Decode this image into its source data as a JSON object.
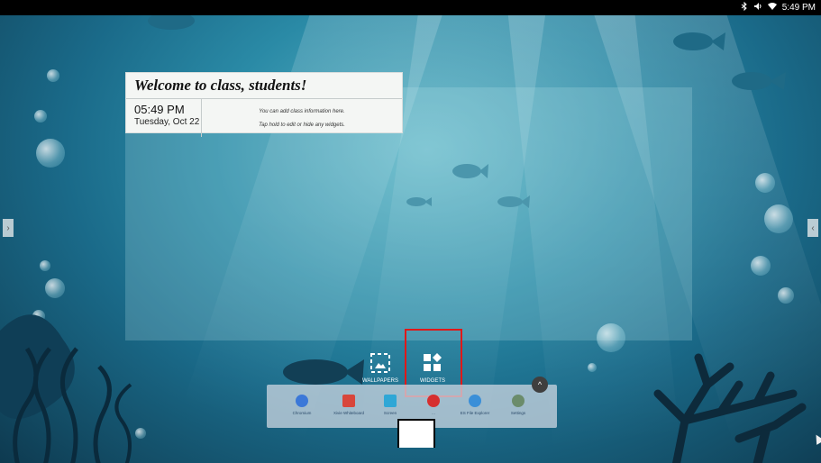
{
  "status_bar": {
    "time": "5:49 PM",
    "icons": [
      "bluetooth-icon",
      "volume-icon",
      "wifi-icon"
    ]
  },
  "widget_card": {
    "title": "Welcome to class, students!",
    "time": "05:49 PM",
    "date": "Tuesday, Oct 22",
    "info_line1": "You can add class information here.",
    "info_line2": "Tap hold to edit or hide any widgets."
  },
  "side_arrows": {
    "left": "›",
    "right": "‹"
  },
  "launcher": {
    "wallpapers_label": "WALLPAPERS",
    "widgets_label": "WIDGETS"
  },
  "dock": {
    "expand_icon": "^",
    "items": [
      {
        "label": "Chromium",
        "color": "#3b78d8"
      },
      {
        "label": "Xivie Whiteboard",
        "color": "#d8463b"
      },
      {
        "label": "Screen",
        "color": "#2fa7d6"
      },
      {
        "label": "...",
        "color": "#d62f2f"
      },
      {
        "label": "ES File Explorer",
        "color": "#3a8fd8"
      },
      {
        "label": "Settings",
        "color": "#6b8c6b"
      }
    ]
  },
  "colors": {
    "highlight": "#e01818",
    "status_bar": "#000000"
  }
}
